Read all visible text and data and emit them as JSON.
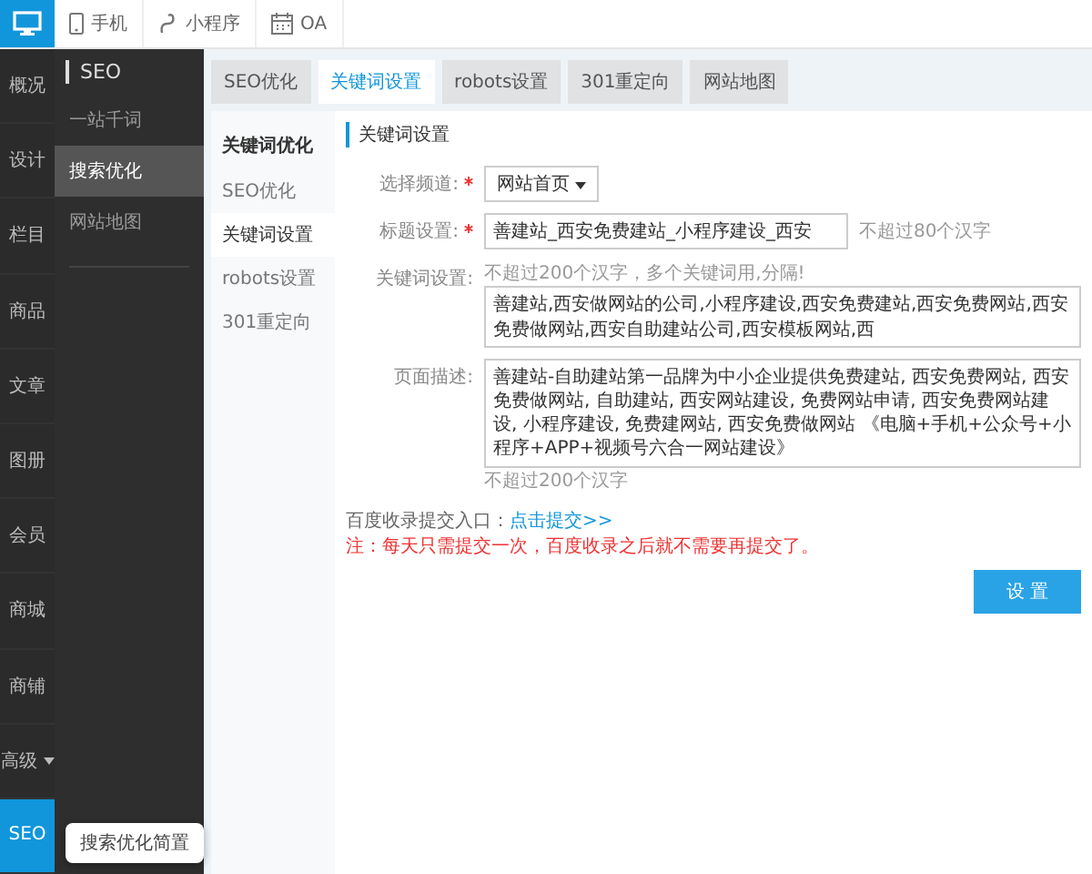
{
  "topbar": {
    "items": [
      {
        "label": "手机"
      },
      {
        "label": "小程序"
      },
      {
        "label": "OA"
      }
    ]
  },
  "main_nav": [
    {
      "label": "概况",
      "selected": false,
      "dropdown": false
    },
    {
      "label": "设计",
      "selected": false,
      "dropdown": false
    },
    {
      "label": "栏目",
      "selected": false,
      "dropdown": false
    },
    {
      "label": "商品",
      "selected": false,
      "dropdown": false
    },
    {
      "label": "文章",
      "selected": false,
      "dropdown": false
    },
    {
      "label": "图册",
      "selected": false,
      "dropdown": false
    },
    {
      "label": "会员",
      "selected": false,
      "dropdown": false
    },
    {
      "label": "商城",
      "selected": false,
      "dropdown": false
    },
    {
      "label": "商铺",
      "selected": false,
      "dropdown": false
    },
    {
      "label": "高级",
      "selected": false,
      "dropdown": true
    },
    {
      "label": "SEO",
      "selected": true,
      "dropdown": false
    }
  ],
  "tooltip": "搜索优化简置",
  "sub_nav": {
    "title": "SEO",
    "items": [
      {
        "label": "一站千词",
        "selected": false
      },
      {
        "label": "搜索优化",
        "selected": true
      },
      {
        "label": "网站地图",
        "selected": false
      }
    ]
  },
  "tabs": [
    {
      "label": "SEO优化",
      "selected": false
    },
    {
      "label": "关键词设置",
      "selected": true
    },
    {
      "label": "robots设置",
      "selected": false
    },
    {
      "label": "301重定向",
      "selected": false
    },
    {
      "label": "网站地图",
      "selected": false
    }
  ],
  "side_menu": {
    "heading": "关键词优化",
    "items": [
      {
        "label": "SEO优化",
        "selected": false
      },
      {
        "label": "关键词设置",
        "selected": true
      },
      {
        "label": "robots设置",
        "selected": false
      },
      {
        "label": "301重定向",
        "selected": false
      }
    ]
  },
  "section_title": "关键词设置",
  "fields": [
    {
      "kind": "select",
      "label": "选择频道:",
      "required": true,
      "value": "网站首页"
    },
    {
      "kind": "input",
      "label": "标题设置:",
      "required": true,
      "value": "善建站_西安免费建站_小程序建设_西安",
      "hint": "不超过80个汉字"
    },
    {
      "kind": "input",
      "label": "关键词设置:",
      "required": false,
      "hint_above": "不超过200个汉字，多个关键词用,分隔!",
      "value": "善建站,西安做网站的公司,小程序建设,西安免费建站,西安免费网站,西安免费做网站,西安自助建站公司,西安模板网站,西"
    },
    {
      "kind": "textarea",
      "label": "页面描述:",
      "required": false,
      "value": "善建站-自助建站第一品牌为中小企业提供免费建站, 西安免费网站, 西安免费做网站, 自助建站, 西安网站建设, 免费网站申请, 西安免费网站建设, 小程序建设, 免费建网站, 西安免费做网站 《电脑+手机+公众号+小程序+APP+视频号六合一网站建设》",
      "hint_below": "不超过200个汉字"
    }
  ],
  "submit_line": {
    "label": "百度收录提交入口：",
    "link": "点击提交>>",
    "warning": "注：每天只需提交一次，百度收录之后就不需要再提交了。"
  },
  "button": "设 置"
}
